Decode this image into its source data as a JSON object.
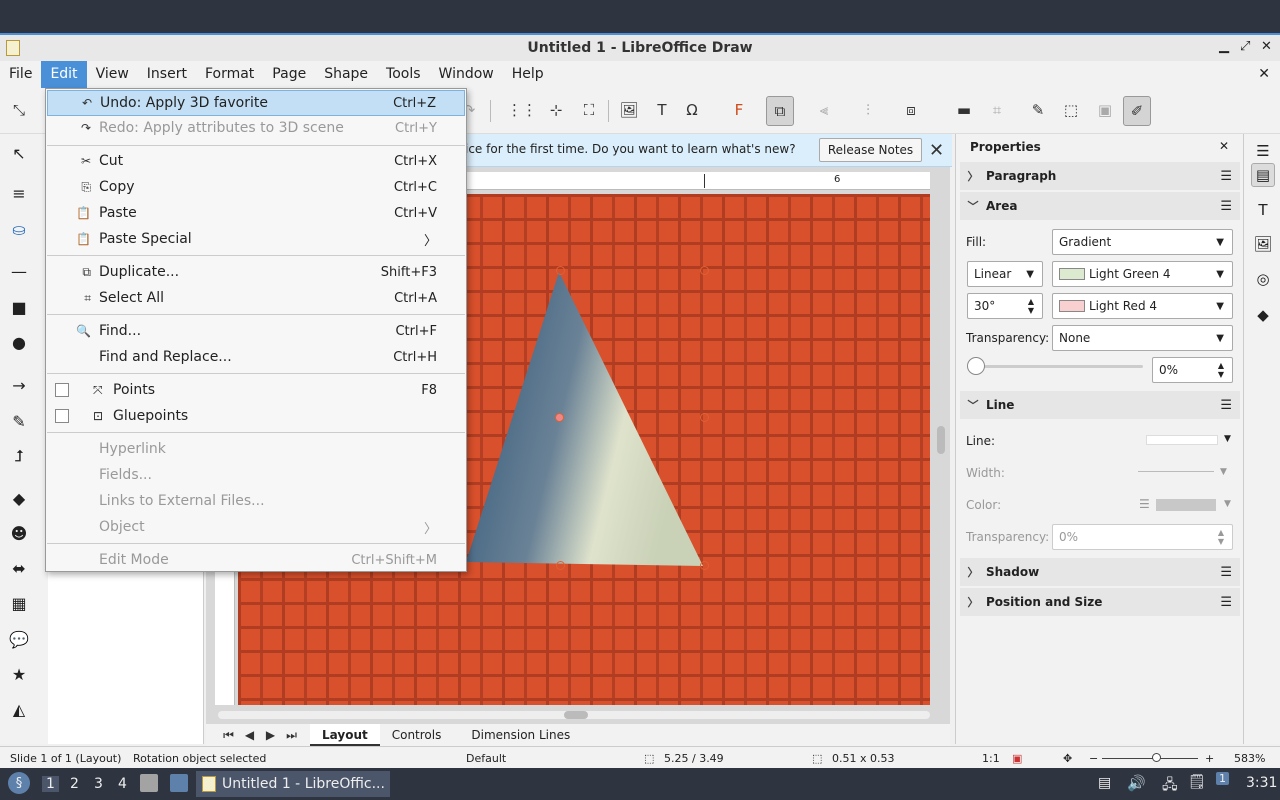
{
  "window": {
    "title": "Untitled 1 - LibreOffice Draw"
  },
  "menubar": [
    "File",
    "Edit",
    "View",
    "Insert",
    "Format",
    "Page",
    "Shape",
    "Tools",
    "Window",
    "Help"
  ],
  "edit_menu": {
    "items": [
      {
        "label": "Undo: Apply 3D favorite",
        "shortcut": "Ctrl+Z",
        "icon": "undo-icon",
        "enabled": true,
        "highlighted": true
      },
      {
        "label": "Redo: Apply attributes to 3D scene",
        "shortcut": "Ctrl+Y",
        "icon": "redo-icon",
        "enabled": false
      },
      {
        "label": "Cut",
        "shortcut": "Ctrl+X",
        "icon": "cut-icon",
        "enabled": true
      },
      {
        "label": "Copy",
        "shortcut": "Ctrl+C",
        "icon": "copy-icon",
        "enabled": true
      },
      {
        "label": "Paste",
        "shortcut": "Ctrl+V",
        "icon": "paste-icon",
        "enabled": true
      },
      {
        "label": "Paste Special",
        "shortcut": "",
        "icon": "paste-special-icon",
        "enabled": true,
        "submenu": true
      },
      {
        "label": "Duplicate...",
        "shortcut": "Shift+F3",
        "icon": "duplicate-icon",
        "enabled": true
      },
      {
        "label": "Select All",
        "shortcut": "Ctrl+A",
        "icon": "select-all-icon",
        "enabled": true
      },
      {
        "label": "Find...",
        "shortcut": "Ctrl+F",
        "icon": "find-icon",
        "enabled": true
      },
      {
        "label": "Find and Replace...",
        "shortcut": "Ctrl+H",
        "icon": "",
        "enabled": true
      },
      {
        "label": "Points",
        "shortcut": "F8",
        "icon": "points-icon",
        "enabled": true,
        "checkbox": true
      },
      {
        "label": "Gluepoints",
        "shortcut": "",
        "icon": "gluepoints-icon",
        "enabled": true,
        "checkbox": true
      },
      {
        "label": "Hyperlink",
        "shortcut": "",
        "enabled": false
      },
      {
        "label": "Fields...",
        "shortcut": "",
        "enabled": false
      },
      {
        "label": "Links to External Files...",
        "shortcut": "",
        "enabled": false
      },
      {
        "label": "Object",
        "shortcut": "",
        "enabled": false,
        "submenu": true
      },
      {
        "label": "Edit Mode",
        "shortcut": "Ctrl+Shift+M",
        "enabled": false
      }
    ]
  },
  "infobar": {
    "message": "ice for the first time. Do you want to learn what's new?",
    "button": "Release Notes"
  },
  "ruler": {
    "mark": "6"
  },
  "tabs": [
    "Layout",
    "Controls",
    "Dimension Lines"
  ],
  "sidebar": {
    "title": "Properties",
    "sections": {
      "paragraph": "Paragraph",
      "area": "Area",
      "line": "Line",
      "shadow": "Shadow",
      "position": "Position and Size"
    },
    "area": {
      "fill_label": "Fill:",
      "fill_value": "Gradient",
      "gradient_type": "Linear",
      "color_from": "Light Green 4",
      "color_to": "Light Red 4",
      "angle": "30°",
      "transparency_label": "Transparency:",
      "transparency_value": "None",
      "slider_percent": "0%",
      "color_from_hex": "#dcebd0",
      "color_to_hex": "#f8d0d0"
    },
    "line": {
      "line_label": "Line:",
      "width_label": "Width:",
      "color_label": "Color:",
      "transparency_label": "Transparency:",
      "transparency_value": "0%"
    }
  },
  "status": {
    "slide": "Slide 1 of 1 (Layout)",
    "selection": "Rotation object selected",
    "master": "Default",
    "position": "5.25 / 3.49",
    "size": "0.51 x 0.53",
    "scale": "1:1",
    "zoom": "583%"
  },
  "taskbar": {
    "workspaces": [
      "1",
      "2",
      "3",
      "4"
    ],
    "task": "Untitled 1 - LibreOffic...",
    "clock": "3:31"
  }
}
